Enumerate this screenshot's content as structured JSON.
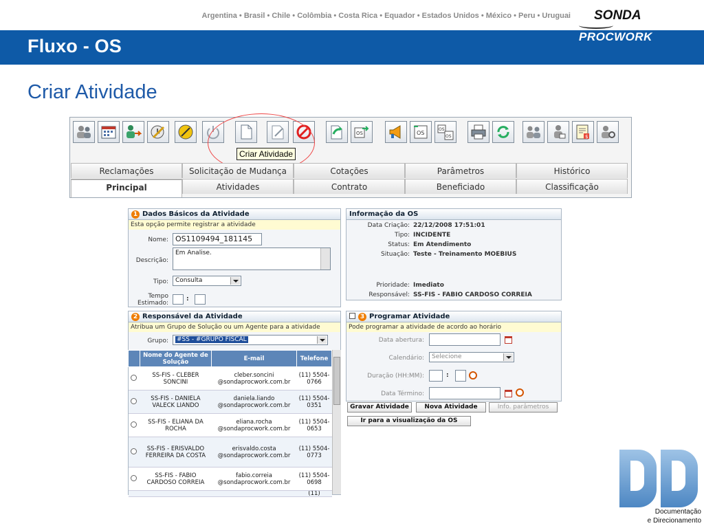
{
  "slide": {
    "countries": "Argentina • Brasil • Chile • Colômbia • Costa Rica • Equador • Estados Unidos • México • Peru • Uruguai",
    "title": "Fluxo - OS",
    "subtitle": "Criar Atividade",
    "brand_top": "SONDA",
    "brand_bottom": "PROCWORK",
    "footer_logo_caption_1": "Documentação",
    "footer_logo_caption_2": "e Direcionamento"
  },
  "toolbar": {
    "tooltip": "Criar Atividade",
    "icons": [
      "users-icon",
      "calendar-icon",
      "transfer-user-icon",
      "clock-edit-icon",
      "pencil-disc-icon",
      "power-icon",
      "new-document-icon",
      "edit-document-icon",
      "cancel-icon",
      "forward-arrow-icon",
      "os-move-icon",
      "megaphone-icon",
      "os-doc-icon",
      "os-split-icon",
      "printer-icon",
      "refresh-icon",
      "people-tools-icon",
      "person-approve-icon",
      "invoice-icon",
      "user-settings-icon"
    ]
  },
  "tabs": {
    "row1": [
      "Reclamações",
      "Solicitação de Mudança",
      "Cotações",
      "Parâmetros",
      "Histórico"
    ],
    "row2": [
      "Principal",
      "Atividades",
      "Contrato",
      "Beneficiado",
      "Classificação"
    ]
  },
  "basic": {
    "title": "Dados Básicos da Atividade",
    "num": "1",
    "note": "Esta opção permite registrar a atividade",
    "nome_label": "Nome:",
    "nome_value": "OS1109494_181145",
    "desc_label": "Descrição:",
    "desc_value": "Em Analise.",
    "tipo_label": "Tipo:",
    "tipo_value": "Consulta",
    "tempo_label_1": "Tempo",
    "tempo_label_2": "Estimado:",
    "colon": ":"
  },
  "info": {
    "title": "Informação da OS",
    "rows": [
      {
        "k": "Data Criação:",
        "v": "22/12/2008 17:51:01"
      },
      {
        "k": "Tipo:",
        "v": "INCIDENTE"
      },
      {
        "k": "Status:",
        "v": "Em Atendimento"
      },
      {
        "k": "Situação:",
        "v": "Teste - Treinamento MOEBIUS"
      },
      {
        "k": "Prioridade:",
        "v": "Imediato"
      },
      {
        "k": "Responsável:",
        "v": "SS-FIS - FABIO CARDOSO CORREIA"
      }
    ]
  },
  "responsible": {
    "title": "Responsável da Atividade",
    "num": "2",
    "note": "Atribua um Grupo de Solução ou um Agente para a atividade",
    "grupo_label": "Grupo:",
    "grupo_value": "#SS - #GRUPO FISCAL",
    "columns": [
      "Nome do Agente de Solução",
      "E-mail",
      "Telefone"
    ],
    "agents": [
      {
        "name": "SS-FIS - CLEBER SONCINI",
        "email": "cleber.soncini @sondaprocwork.com.br",
        "phone": "(11) 5504-0766"
      },
      {
        "name": "SS-FIS - DANIELA VALECK LIANDO",
        "email": "daniela.liando @sondaprocwork.com.br",
        "phone": "(11) 5504-0351"
      },
      {
        "name": "SS-FIS - ELIANA DA ROCHA",
        "email": "eliana.rocha @sondaprocwork.com.br",
        "phone": "(11) 5504-0653"
      },
      {
        "name": "SS-FIS - ERISVALDO FERREIRA DA COSTA",
        "email": "erisvaldo.costa @sondaprocwork.com.br",
        "phone": "(11) 5504-0773"
      },
      {
        "name": "SS-FIS - FABIO CARDOSO CORREIA",
        "email": "fabio.correia @sondaprocwork.com.br",
        "phone": "(11) 5504-0698"
      }
    ],
    "partial_phone": "(11)"
  },
  "schedule": {
    "title": "Programar Atividade",
    "num": "3",
    "note": "Pode programar a atividade de acordo ao horário",
    "abertura_label": "Data abertura:",
    "calendario_label": "Calendário:",
    "calendario_value": "Selecione",
    "duracao_label": "Duração (HH:MM):",
    "termino_label": "Data Término:",
    "colon": ":"
  },
  "buttons": {
    "gravar": "Gravar Atividade",
    "nova": "Nova Atividade",
    "info_param": "Info. parâmetros",
    "ir_os": "Ir para a visualização da OS"
  },
  "colors": {
    "banner": "#0e5aa7",
    "subtitle": "#1e5aa8",
    "table_header": "#5d86b8",
    "step_badge": "#ef7d00",
    "highlight": "#e44444"
  }
}
